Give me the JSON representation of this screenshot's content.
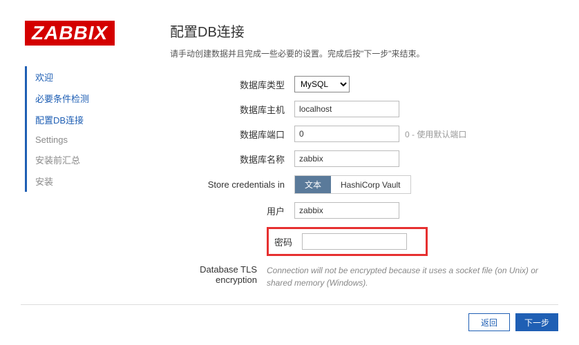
{
  "logo": "ZABBIX",
  "nav": {
    "welcome": "欢迎",
    "prereq": "必要条件检测",
    "dbconfig": "配置DB连接",
    "settings": "Settings",
    "presummary": "安装前汇总",
    "install": "安装"
  },
  "page": {
    "title": "配置DB连接",
    "subtitle": "请手动创建数据并且完成一些必要的设置。完成后按\"下一步\"来结束。"
  },
  "form": {
    "db_type_label": "数据库类型",
    "db_type_value": "MySQL",
    "db_host_label": "数据库主机",
    "db_host_value": "localhost",
    "db_port_label": "数据库端口",
    "db_port_value": "0",
    "db_port_hint": "0 - 使用默认端口",
    "db_name_label": "数据库名称",
    "db_name_value": "zabbix",
    "creds_label": "Store credentials in",
    "creds_opt1": "文本",
    "creds_opt2": "HashiCorp Vault",
    "user_label": "用户",
    "user_value": "zabbix",
    "password_label": "密码",
    "password_value": "",
    "tls_label": "Database TLS encryption",
    "tls_note": "Connection will not be encrypted because it uses a socket file (on Unix) or shared memory (Windows)."
  },
  "buttons": {
    "back": "返回",
    "next": "下一步"
  }
}
